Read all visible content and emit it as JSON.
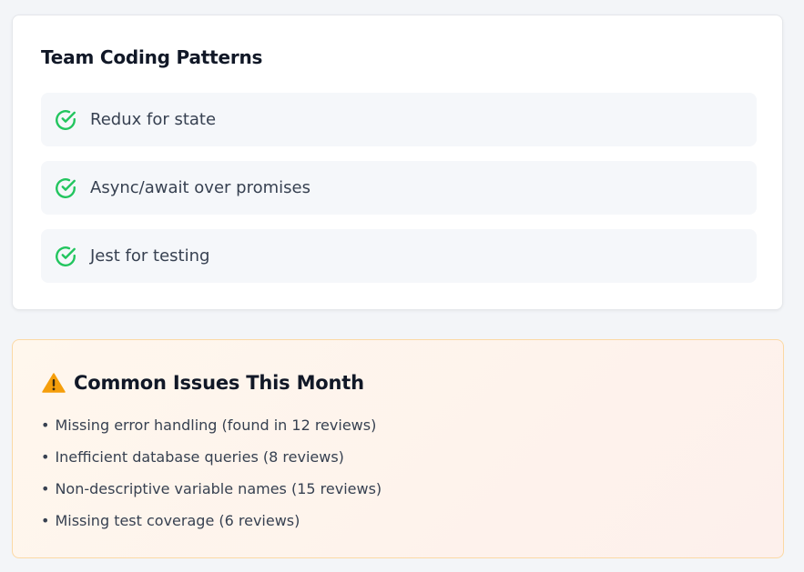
{
  "patterns_card": {
    "title": "Team Coding Patterns",
    "items": [
      {
        "label": "Redux for state",
        "icon": "check-circle-icon"
      },
      {
        "label": "Async/await over promises",
        "icon": "check-circle-icon"
      },
      {
        "label": "Jest for testing",
        "icon": "check-circle-icon"
      }
    ]
  },
  "issues_card": {
    "title": "Common Issues This Month",
    "icon": "warning-icon",
    "bullet": "•",
    "items": [
      "Missing error handling (found in 12 reviews)",
      "Inefficient database queries (8 reviews)",
      "Non-descriptive variable names (15 reviews)",
      "Missing test coverage (6 reviews)"
    ]
  },
  "colors": {
    "check": "#22c55e",
    "warning": "#f59e0b",
    "page_background": "#f3f5f8",
    "issues_border": "#fbd9a5"
  }
}
